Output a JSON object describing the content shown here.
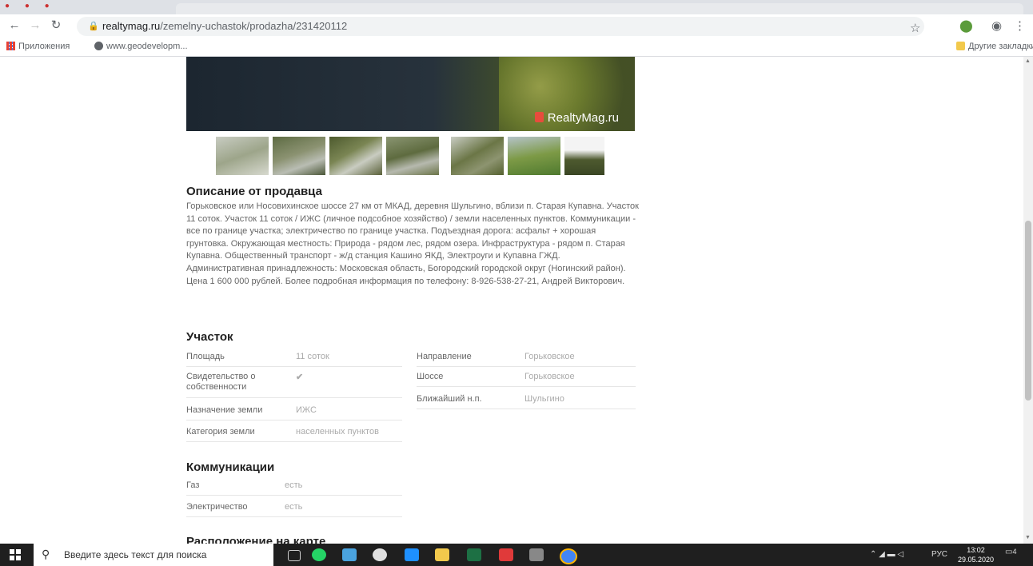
{
  "browser": {
    "url_domain": "realtymag.ru",
    "url_path": "/zemelny-uchastok/prodazha/231420112",
    "bookmarks": [
      {
        "label": "Приложения",
        "icon": "apps-grid-icon"
      },
      {
        "label": "www.geodevelopm...",
        "icon": "globe-icon"
      }
    ],
    "other_bookmarks": "Другие закладки"
  },
  "listing": {
    "watermark": "RealtyMag.ru",
    "thumbnail_count": 7,
    "description_title": "Описание от продавца",
    "description": "Горьковское или Носовихинское шоссе 27 км от МКАД, деревня Шульгино, вблизи п. Старая Купавна. Участок 11 соток. Участок 11 соток / ИЖС (личное подсобное хозяйство) / земли населенных пунктов. Коммуникации - все по границе участка; электричество по границе участка. Подъездная дорога: асфальт + хорошая грунтовка. Окружающая местность: Природа - рядом лес, рядом озера. Инфраструктура - рядом п. Старая Купавна. Общественный транспорт - ж/д станция Кашино ЯКД, Электроуги и Купавна ГЖД. Административная принадлежность: Московская область, Богородский городской округ (Ногинский район). Цена 1 600 000 рублей. Более подробная информация по телефону: 8-926-538-27-21, Андрей Викторович.",
    "plot_title": "Участок",
    "plot_left": [
      {
        "key": "Площадь",
        "value": "11 соток"
      },
      {
        "key": "Свидетельство о собственности",
        "value": "✔"
      },
      {
        "key": "Назначение земли",
        "value": "ИЖС"
      },
      {
        "key": "Категория земли",
        "value": "населенных пунктов"
      }
    ],
    "plot_right": [
      {
        "key": "Направление",
        "value": "Горьковское"
      },
      {
        "key": "Шоссе",
        "value": "Горьковское"
      },
      {
        "key": "Ближайший н.п.",
        "value": "Шульгино"
      }
    ],
    "comm_title": "Коммуникации",
    "comm": [
      {
        "key": "Газ",
        "value": "есть"
      },
      {
        "key": "Электричество",
        "value": "есть"
      }
    ],
    "cut_heading": "Расположение на карте"
  },
  "taskbar": {
    "search_placeholder": "Введите здесь текст для поиска",
    "tray_text": "РУС",
    "time": "13:02",
    "date": "29.05.2020",
    "notification_count": "4"
  }
}
